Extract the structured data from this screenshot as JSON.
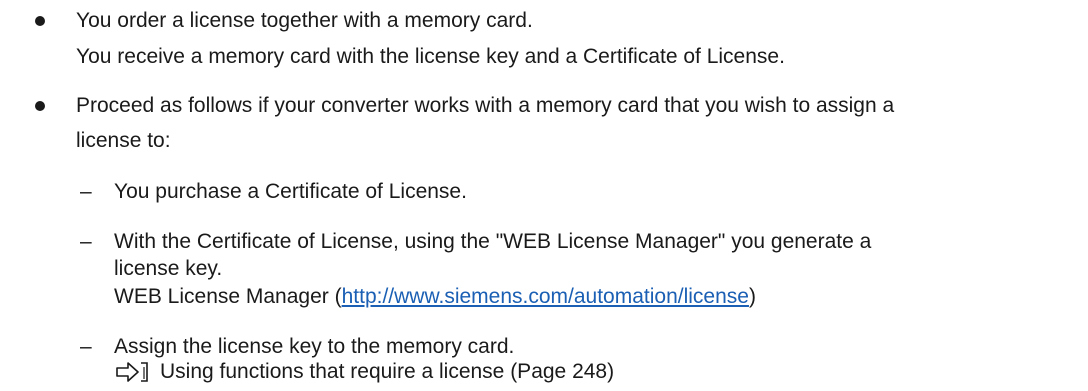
{
  "items": [
    {
      "line1": "You order a license together with a memory card.",
      "line2": "You receive a memory card with the license key and a Certificate of License."
    },
    {
      "line1": "Proceed as follows if your converter works with a memory card that you wish to assign a",
      "line2": "license to:",
      "steps": [
        {
          "line1": "You purchase a Certificate of License."
        },
        {
          "line1": "With the Certificate of License, using the \"WEB License Manager\" you generate a",
          "line2": "license key.",
          "link_prefix": "WEB License Manager (",
          "link_text": "http://www.siemens.com/automation/license",
          "link_suffix": ")"
        },
        {
          "line1": "Assign the license key to the memory card.",
          "ref_text": "Using functions that require a license (Page 248)",
          "ref_icon": "cross-reference-icon"
        }
      ]
    }
  ],
  "dash_char": "–"
}
